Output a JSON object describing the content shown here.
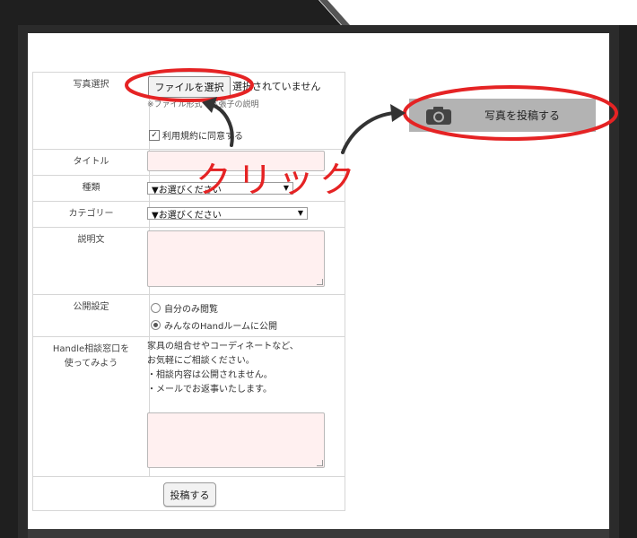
{
  "colors": {
    "annotation_red": "#e52324",
    "input_pink": "#fff0f0",
    "frame_dark": "#1f1f1f",
    "post_button_gray": "#b3b3b3"
  },
  "form": {
    "photo_label": "写真選択",
    "file_button": "ファイルを選択",
    "file_status": "選択されていません",
    "ext_note": "※ファイル形式・拡張子の説明",
    "agree_label": "利用規約に同意する",
    "title_label": "タイトル",
    "type_label": "種類",
    "type_select": "▼お選びください",
    "category_label": "カテゴリー",
    "category_select": "▼お選びください",
    "description_label": "説明文",
    "visibility_label": "公開設定",
    "visibility_options": [
      {
        "label": "自分のみ閲覧",
        "selected": false
      },
      {
        "label": "みんなのHandルームに公開",
        "selected": true
      }
    ],
    "consult_label_line1": "Handle相談窓口を",
    "consult_label_line2": "使ってみよう",
    "consult_lines": [
      "家具の組合せやコーディネートなど、",
      "お気軽にご相談ください。",
      "・相談内容は公開されません。",
      "・メールでお返事いたします。"
    ],
    "submit_button": "投稿する"
  },
  "post_photo_button": {
    "label": "写真を投稿する",
    "icon": "camera-icon"
  },
  "annotation": {
    "click_text": "クリック"
  }
}
